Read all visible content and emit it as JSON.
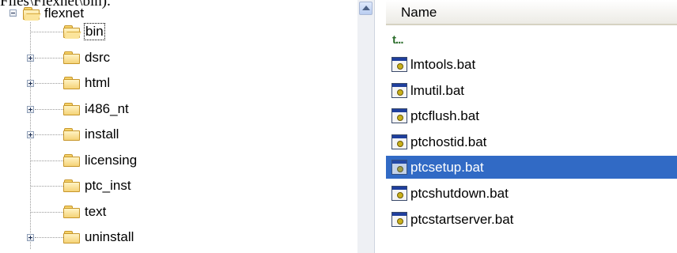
{
  "caption": "Files\\Flexnet\\bin).",
  "tree": {
    "root": {
      "label": "flexnet",
      "expanded": true
    },
    "items": [
      {
        "label": "bin",
        "expandable": false,
        "selected": true,
        "open": true
      },
      {
        "label": "dsrc",
        "expandable": true
      },
      {
        "label": "html",
        "expandable": true
      },
      {
        "label": "i486_nt",
        "expandable": true
      },
      {
        "label": "install",
        "expandable": true
      },
      {
        "label": "licensing",
        "expandable": false
      },
      {
        "label": "ptc_inst",
        "expandable": false
      },
      {
        "label": "text",
        "expandable": false
      },
      {
        "label": "uninstall",
        "expandable": true
      }
    ]
  },
  "file_list": {
    "column_header": "Name",
    "up_glyph": "t...",
    "files": [
      {
        "name": "lmtools.bat"
      },
      {
        "name": "lmutil.bat"
      },
      {
        "name": "ptcflush.bat"
      },
      {
        "name": "ptchostid.bat"
      },
      {
        "name": "ptcsetup.bat",
        "selected": true
      },
      {
        "name": "ptcshutdown.bat"
      },
      {
        "name": "ptcstartserver.bat"
      }
    ],
    "selected_color": "#316ac5"
  }
}
